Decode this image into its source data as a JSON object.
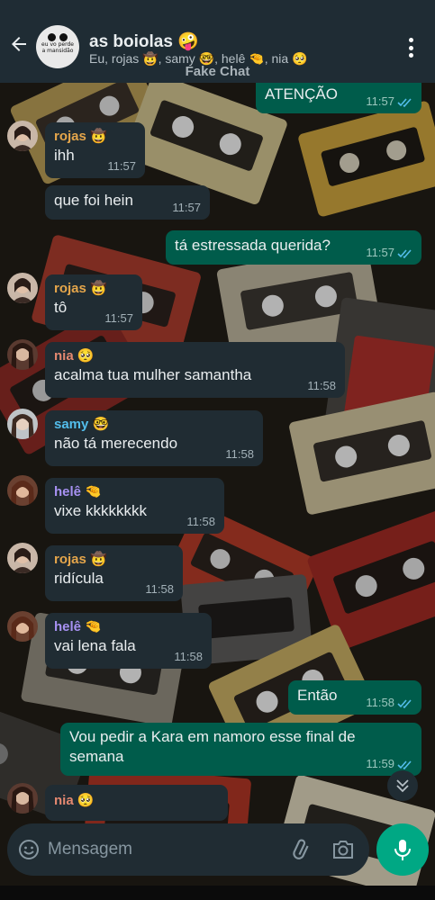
{
  "header": {
    "title": "as boiolas 🤪",
    "members": "Eu, rojas 🤠, samy 🤓, helê 🤏, nia 🥺",
    "avatar_sign": "eu vo perde a mansidão",
    "watermark": "Fake Chat"
  },
  "messages": [
    {
      "type": "out",
      "text": "ATENÇÃO",
      "time": "11:57"
    },
    {
      "type": "in",
      "sender": "rojas 🤠",
      "sender_color": "#e5a64b",
      "text": "ihh",
      "time": "11:57"
    },
    {
      "type": "in",
      "text": "que foi hein",
      "time": "11:57"
    },
    {
      "type": "out",
      "text": "tá estressada querida?",
      "time": "11:57"
    },
    {
      "type": "in",
      "sender": "rojas 🤠",
      "sender_color": "#e5a64b",
      "text": "tô",
      "time": "11:57"
    },
    {
      "type": "in",
      "sender": "nia 🥺",
      "sender_color": "#e48870",
      "text": "acalma tua mulher samantha",
      "time": "11:58"
    },
    {
      "type": "in",
      "sender": "samy 🤓",
      "sender_color": "#53bdeb",
      "text": "não tá merecendo",
      "time": "11:58"
    },
    {
      "type": "in",
      "sender": "helê 🤏",
      "sender_color": "#a791f2",
      "text": "vixe kkkkkkkk",
      "time": "11:58"
    },
    {
      "type": "in",
      "sender": "rojas 🤠",
      "sender_color": "#e5a64b",
      "text": "ridícula",
      "time": "11:58"
    },
    {
      "type": "in",
      "sender": "helê 🤏",
      "sender_color": "#a791f2",
      "text": "vai lena fala",
      "time": "11:58"
    },
    {
      "type": "out",
      "text": "Então",
      "time": "11:58"
    },
    {
      "type": "out",
      "text": "Vou pedir a Kara em namoro esse final de semana",
      "time": "11:59"
    },
    {
      "type": "in",
      "sender": "nia 🥺",
      "sender_color": "#e48870",
      "text": "",
      "time": ""
    }
  ],
  "input": {
    "placeholder": "Mensagem"
  },
  "colors": {
    "header_bg": "#1f2c34",
    "incoming_bubble": "#202c33",
    "outgoing_bubble": "#005c4b",
    "accent": "#00a884",
    "read_ticks": "#53bdeb"
  }
}
